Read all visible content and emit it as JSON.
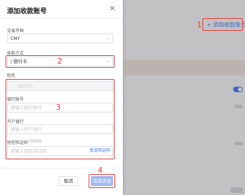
{
  "background": {
    "add_button_label": "+ 添加收款账号"
  },
  "modal": {
    "title": "添加收款账号",
    "close_glyph": "×",
    "currency": {
      "label": "交易币种",
      "value": "CNY"
    },
    "payment_method": {
      "label": "收款方式",
      "value": "| 银行卡"
    },
    "name": {
      "label": "姓名"
    },
    "bank_account": {
      "label": "银行账号",
      "placeholder": "请输入银行账号"
    },
    "bank": {
      "label": "开户银行",
      "placeholder": "请输入开户银行"
    },
    "verification": {
      "label": "短信验证码",
      "placeholder": "请输入短信验证码",
      "send_label": "发送验证码"
    },
    "cancel_label": "取消",
    "done_label": "完成添加"
  },
  "annotations": {
    "n1": "1",
    "n2": "2",
    "n3": "3",
    "n4": "4",
    "color": "#e53935"
  },
  "colors": {
    "accent": "#3b6ff5",
    "done_disabled": "#9fb9f3"
  }
}
